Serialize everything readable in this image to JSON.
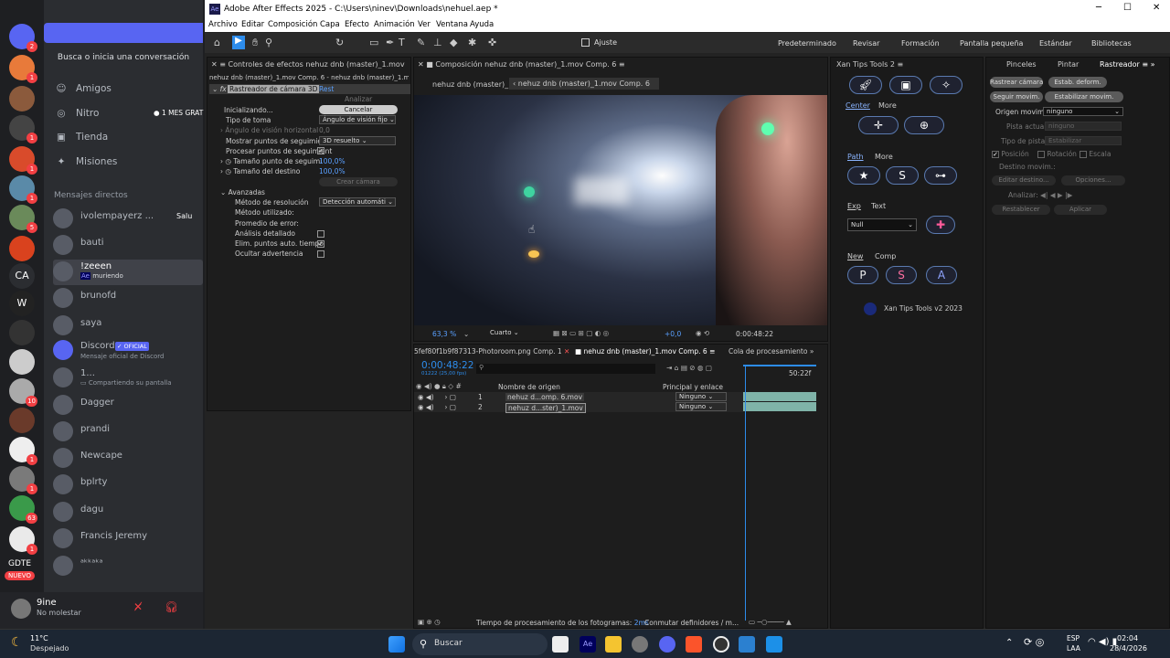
{
  "discord": {
    "search_placeholder": "Busca o inicia una conversación",
    "nav": [
      {
        "label": "Amigos",
        "icon": "wave-icon"
      },
      {
        "label": "Nitro",
        "icon": "nitro-icon",
        "badge": "1 MES GRAT"
      },
      {
        "label": "Tienda",
        "icon": "shop-icon"
      },
      {
        "label": "Misiones",
        "icon": "quest-icon"
      }
    ],
    "dm_header": "Mensajes directos",
    "dms": [
      {
        "name": "ivolempayerz ...",
        "sub": "",
        "extra": "Salu"
      },
      {
        "name": "bauti",
        "sub": ""
      },
      {
        "name": "!zeeen",
        "sub": "muriendo",
        "sub_prefix": "Ae"
      },
      {
        "name": "brunofd",
        "sub": ""
      },
      {
        "name": "saya",
        "sub": ""
      },
      {
        "name": "Discord",
        "sub": "Mensaje oficial de Discord",
        "badge": "OFICIAL"
      },
      {
        "name": "1...",
        "sub": "Compartiendo su pantalla"
      },
      {
        "name": "Dagger",
        "sub": ""
      },
      {
        "name": "prandi",
        "sub": ""
      },
      {
        "name": "Newcape",
        "sub": ""
      },
      {
        "name": "bplrty",
        "sub": ""
      },
      {
        "name": "dagu",
        "sub": ""
      },
      {
        "name": "Francis Jeremy",
        "sub": ""
      },
      {
        "name": "ᵃᵏᵏᵃᵏᵃ",
        "sub": ""
      }
    ],
    "server_badges": [
      "2",
      "1",
      "1",
      "1",
      "1",
      "5",
      "10",
      "1",
      "1",
      "63",
      "1",
      "1"
    ],
    "server_labels": {
      "ca": "CA",
      "w": "W",
      "gdte": "GDTE",
      "nuevo": "NUEVO"
    },
    "user": {
      "name": "9ine",
      "status": "No molestar"
    }
  },
  "ae": {
    "title": "Adobe After Effects 2025 - C:\\Users\\ninev\\Downloads\\nehuel.aep *",
    "menu": [
      "Archivo",
      "Editar",
      "Composición",
      "Capa",
      "Efecto",
      "Animación",
      "Ver",
      "Ventana",
      "Ayuda"
    ],
    "ajuste": "Ajuste",
    "workspaces": [
      "Predeterminado",
      "Revisar",
      "Formación",
      "Pantalla pequeña",
      "Estándar",
      "Bibliotecas"
    ],
    "effects": {
      "tab": "Controles de efectos nehuz dnb (master)_1.mov",
      "crumb": "nehuz dnb (master)_1.mov Comp. 6 - nehuz dnb (master)_1.mov",
      "fx_name": "Rastreador de cámara 3D",
      "reset": "Rest",
      "analyze_btn": "Analizar",
      "cancel_btn": "Cancelar",
      "status": "Inicializando...",
      "rows": [
        {
          "label": "Tipo de toma",
          "value": "Ángulo de visión fijo"
        },
        {
          "label": "Ángulo de visión horizontal",
          "value": "0,0"
        },
        {
          "label": "Mostrar puntos de seguimient",
          "value": "3D resuelto"
        },
        {
          "label": "Procesar puntos de seguimient",
          "value": ""
        },
        {
          "label": "Tamaño punto de seguimi",
          "value": "100,0%"
        },
        {
          "label": "Tamaño del destino",
          "value": "100,0%"
        }
      ],
      "create_camera": "Crear cámara",
      "advanced": "Avanzadas",
      "adv_rows": [
        {
          "label": "Método de resolución",
          "value": "Detección automáti"
        },
        {
          "label": "Método utilizado:",
          "value": ""
        },
        {
          "label": "Promedio de error:",
          "value": ""
        },
        {
          "label": "Análisis detallado",
          "checked": false
        },
        {
          "label": "Elim. puntos auto. tiempo",
          "checked": true
        },
        {
          "label": "Ocultar advertencia",
          "checked": false
        }
      ]
    },
    "composition": {
      "tab": "Composición nehuz dnb (master)_1.mov Comp. 6",
      "sub_tabs": [
        "nehuz dnb (master)_1",
        "nehuz dnb (master)_1.mov Comp. 6"
      ],
      "zoom": "63,3 %",
      "quality": "Cuarto",
      "exposure": "+0,0",
      "timecode": "0:00:48:22"
    },
    "xan": {
      "title": "Xan Tips Tools 2",
      "sections": [
        "Center",
        "More",
        "Path",
        "More",
        "Exp",
        "Text",
        "New",
        "Comp"
      ],
      "null_value": "Null",
      "letters": [
        "P",
        "S",
        "A"
      ],
      "footer": "Xan Tips Tools v2 2023"
    },
    "tracker": {
      "tabs": [
        "Pinceles",
        "Pintar",
        "Rastreador"
      ],
      "buttons": [
        "Rastrear cámara",
        "Estab. deform.",
        "Seguir movim.",
        "Estabilizar movim."
      ],
      "rows": [
        {
          "label": "Origen movim.:",
          "value": "ninguno"
        },
        {
          "label": "Pista actual:",
          "value": "ninguno"
        },
        {
          "label": "Tipo de pista:",
          "value": "Estabilizar"
        }
      ],
      "checks": [
        "Posición",
        "Rotación",
        "Escala"
      ],
      "dest": "Destino movim.:",
      "edit_dest": "Editar destino...",
      "options": "Opciones...",
      "analyze": "Analizar:",
      "reset": "Restablecer",
      "apply": "Aplicar"
    },
    "timeline": {
      "tabs": [
        "5fef80f1b9f87313-Photoroom.png Comp. 1",
        "nehuz dnb (master)_1.mov Comp. 6",
        "Cola de procesamiento"
      ],
      "timecode": "0:00:48:22",
      "fps": "01222 (25,00 fps)",
      "search_placeholder": "",
      "col_source": "Nombre de origen",
      "col_parent": "Principal y enlace",
      "ruler_end": "50:22f",
      "layers": [
        {
          "num": "1",
          "name": "nehuz d...omp. 6.mov",
          "parent": "Ninguno"
        },
        {
          "num": "2",
          "name": "nehuz d...ster)_1.mov",
          "parent": "Ninguno"
        }
      ],
      "footer": "Tiempo de procesamiento de los fotogramas:",
      "footer_val": "2ms",
      "toggle": "Conmutar definidores / m..."
    }
  },
  "taskbar": {
    "weather_temp": "11°C",
    "weather_desc": "Despejado",
    "search": "Buscar",
    "lang": "ESP",
    "lang2": "LAA",
    "time": "02:04",
    "date": "28/4/2026"
  },
  "colors": {
    "discord_blurple": "#5865f2",
    "ae_blue": "#2d8ceb",
    "timeline_bar": "#7fb3a8"
  }
}
